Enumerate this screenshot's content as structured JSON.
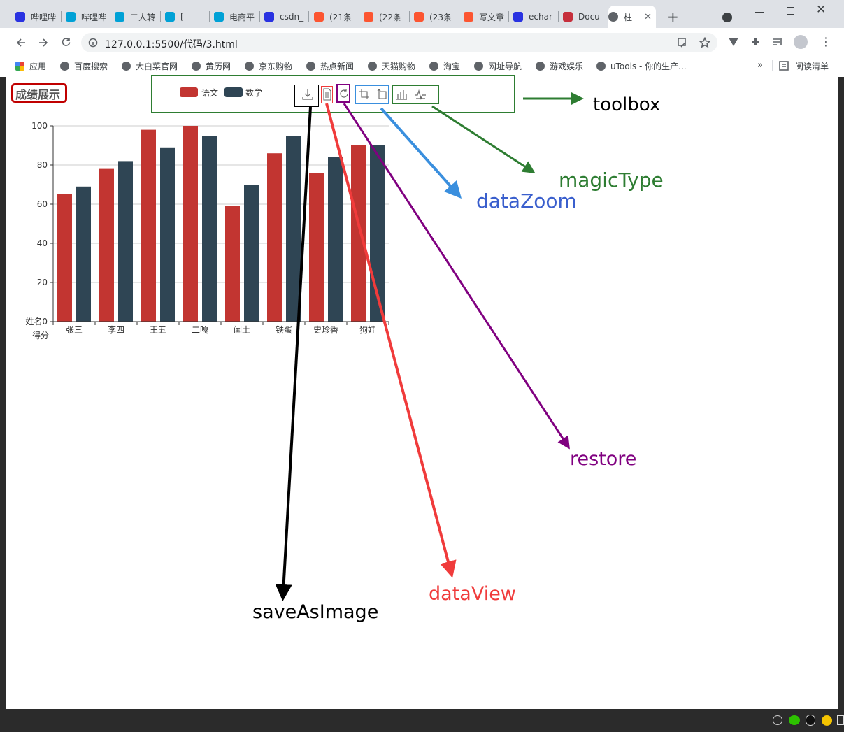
{
  "browser": {
    "tabs": [
      {
        "label": "哔哩哔",
        "fav": "baidu-paw-icon",
        "color": "#2932e1"
      },
      {
        "label": "哔哩哔",
        "fav": "bilibili-icon",
        "color": "#00a1d6"
      },
      {
        "label": "二人转",
        "fav": "bilibili-icon",
        "color": "#00a1d6"
      },
      {
        "label": "[",
        "fav": "bilibili-icon",
        "color": "#00a1d6"
      },
      {
        "label": "电商平",
        "fav": "bilibili-icon",
        "color": "#00a1d6"
      },
      {
        "label": "csdn_",
        "fav": "baidu-paw-icon",
        "color": "#2932e1"
      },
      {
        "label": "(21条",
        "fav": "csdn-icon",
        "color": "#fc5531"
      },
      {
        "label": "(22条",
        "fav": "csdn-icon",
        "color": "#fc5531"
      },
      {
        "label": "(23条",
        "fav": "csdn-icon",
        "color": "#fc5531"
      },
      {
        "label": "写文章",
        "fav": "csdn-icon",
        "color": "#fc5531"
      },
      {
        "label": "echar",
        "fav": "baidu-paw-icon",
        "color": "#2932e1"
      },
      {
        "label": "Docu",
        "fav": "record-icon",
        "color": "#c62f3c"
      },
      {
        "label": "柱",
        "fav": "globe-icon",
        "color": "#5f6368"
      }
    ],
    "url": "127.0.0.1:5500/代码/3.html",
    "bookmarks": [
      "应用",
      "百度搜索",
      "大白菜官网",
      "黄历网",
      "京东购物",
      "热点新闻",
      "天猫购物",
      "淘宝",
      "网址导航",
      "游戏娱乐",
      "uTools - 你的生产..."
    ],
    "more_bookmarks": "»",
    "reading_list": "阅读清单"
  },
  "chart_page": {
    "title": "成绩展示",
    "accent": "#c23531",
    "secondary": "#2f4554",
    "toolbox_colors": {
      "toolbox": "#2e7d32",
      "saveAsImage": "#000000",
      "dataView": "#f03b3b",
      "restore": "#800080",
      "dataZoom": "#3a8fde",
      "magicType": "#2e7d32"
    }
  },
  "chart_data": {
    "type": "bar",
    "title": "成绩展示",
    "categories": [
      "张三",
      "李四",
      "王五",
      "二嘎",
      "闰土",
      "铁蛋",
      "史珍香",
      "狗娃"
    ],
    "series": [
      {
        "name": "语文",
        "values": [
          65,
          78,
          98,
          100,
          59,
          86,
          76,
          90
        ]
      },
      {
        "name": "数学",
        "values": [
          69,
          82,
          89,
          95,
          70,
          95,
          84,
          90
        ]
      }
    ],
    "xlabel": "姓名",
    "ylabel": "得分",
    "ylim": [
      0,
      100
    ],
    "yticks": [
      0,
      20,
      40,
      60,
      80,
      100
    ],
    "grid": true,
    "legend": "top-center"
  },
  "annotations": {
    "toolbox": "toolbox",
    "magicType": "magicType",
    "dataZoom": "dataZoom",
    "restore": "restore",
    "dataView": "dataView",
    "saveAsImage": "saveAsImage"
  }
}
